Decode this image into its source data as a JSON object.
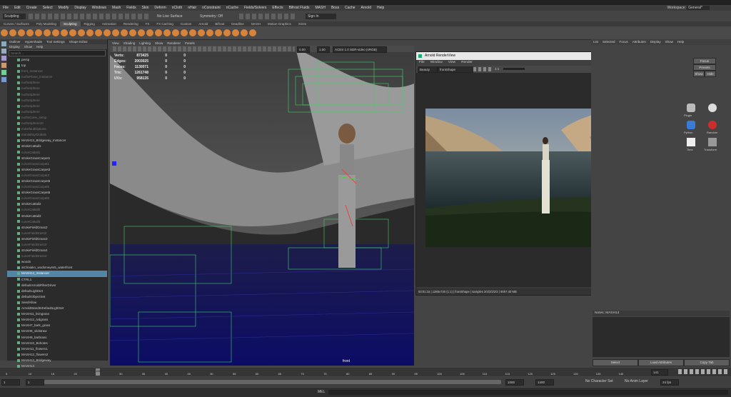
{
  "app": {
    "workspace_label": "Workspace:",
    "workspace_value": "General*"
  },
  "menubar": [
    "File",
    "Edit",
    "Create",
    "Select",
    "Modify",
    "Display",
    "Windows",
    "Mash",
    "Fields",
    "Skin",
    "Deform",
    "nCloth",
    "nHair",
    "nConstraint",
    "nCache",
    "Fields/Solvers",
    "Effects",
    "Bifrost Fluids",
    "MASH",
    "Boss",
    "Cache",
    "Arnold",
    "Help"
  ],
  "status": {
    "mode": "Sculpting",
    "surface": "No Live Surface",
    "symmetry": "Symmetry: Off",
    "sign_in": "Sign In"
  },
  "shelf_tabs": [
    "Curves / Surfaces",
    "Poly Modeling",
    "Sculpting",
    "Rigging",
    "Animation",
    "Rendering",
    "FX",
    "FX Caching",
    "Custom",
    "Arnold",
    "Bifrost",
    "Deadline",
    "MASH",
    "Motion Graphics",
    "XGen"
  ],
  "shelf_active": "Sculpting",
  "outliner": {
    "tabs": [
      "Outliner",
      "Hypershade",
      "Tool Settings",
      "Shape Editor"
    ],
    "menu": [
      "Display",
      "Show",
      "Help"
    ],
    "search_placeholder": "Search...",
    "items": [
      {
        "label": "persp",
        "dim": false
      },
      {
        "label": "top",
        "dim": false
      },
      {
        "label": "front_Instancer",
        "dim": true
      },
      {
        "label": "nurbsPlane_instancer",
        "dim": true
      },
      {
        "label": "nurbsSphere",
        "dim": true
      },
      {
        "label": "nurbsSphere",
        "dim": true
      },
      {
        "label": "nurbsSphere",
        "dim": true
      },
      {
        "label": "nurbsSphere",
        "dim": true
      },
      {
        "label": "nurbsSphere",
        "dim": true
      },
      {
        "label": "nurbsSphere",
        "dim": true
      },
      {
        "label": "nurbsCone_setup",
        "dim": true
      },
      {
        "label": "nurbsSphere10",
        "dim": true
      },
      {
        "label": "miDefaultOptions",
        "dim": true
      },
      {
        "label": "mentalrayGlobals",
        "dim": true
      },
      {
        "label": "MASH13_Bridgeway_Instancer",
        "dim": false
      },
      {
        "label": "strokeCattail1",
        "dim": false
      },
      {
        "label": "curveCattail1",
        "dim": true
      },
      {
        "label": "strokeGrassCarpet1",
        "dim": false
      },
      {
        "label": "curveGrassCarpet1",
        "dim": true
      },
      {
        "label": "strokeGrassCarpet3",
        "dim": false
      },
      {
        "label": "curveGrassCarpet3",
        "dim": true
      },
      {
        "label": "strokeGrassCarpet5",
        "dim": false
      },
      {
        "label": "curveGrassCarpet5",
        "dim": true
      },
      {
        "label": "strokeGrassCarpet6",
        "dim": false
      },
      {
        "label": "curveGrassCarpet6",
        "dim": true
      },
      {
        "label": "strokeCattail2",
        "dim": false
      },
      {
        "label": "curveCattail2",
        "dim": true
      },
      {
        "label": "strokeCattail3",
        "dim": false
      },
      {
        "label": "curveCattail3",
        "dim": true
      },
      {
        "label": "strokeFieldGrass2",
        "dim": false
      },
      {
        "label": "curveFieldGrass2",
        "dim": true
      },
      {
        "label": "strokeFieldGrass3",
        "dim": false
      },
      {
        "label": "curveFieldGrass3",
        "dim": true
      },
      {
        "label": "strokeFieldGrass4",
        "dim": false
      },
      {
        "label": "curveFieldGrass4",
        "dim": true
      },
      {
        "label": "woods",
        "dim": false
      },
      {
        "label": "aiChaiakn_wodsmeyes5_waterfront",
        "dim": false
      },
      {
        "label": "MASH14_Instancer",
        "dim": false,
        "selected": true
      },
      {
        "label": "CTRL1",
        "dim": false
      },
      {
        "label": "defaultArnoldFilterDriver",
        "dim": false
      },
      {
        "label": "defaultLightSet",
        "dim": false
      },
      {
        "label": "defaultObjectSet",
        "dim": false
      },
      {
        "label": "SeedAllow",
        "dim": false
      },
      {
        "label": "ArnoldStandInDefaultLightSet",
        "dim": false
      },
      {
        "label": "MASH11_livingrass",
        "dim": false
      },
      {
        "label": "MASH12_ivdgrass",
        "dim": false
      },
      {
        "label": "MASH7_bark_grass",
        "dim": false
      },
      {
        "label": "MASH8_sildstraw",
        "dim": false
      },
      {
        "label": "MASH9_barbrass",
        "dim": false
      },
      {
        "label": "MASH10_Bshotes",
        "dim": false
      },
      {
        "label": "MASH11_flowers1",
        "dim": false
      },
      {
        "label": "MASH12_flowers2",
        "dim": false
      },
      {
        "label": "MASH13_Bridgeway",
        "dim": false
      },
      {
        "label": "MASH14",
        "dim": false
      }
    ]
  },
  "viewport": {
    "menu": [
      "View",
      "Shading",
      "Lighting",
      "Show",
      "Renderer",
      "Panels"
    ],
    "colorspace": "ACES 1.0 SDR-video (sRGB)",
    "gamma": "1.00",
    "exposure": "0.00",
    "hud": [
      {
        "key": "Verts:",
        "val": "873425",
        "z1": "0",
        "z2": "0"
      },
      {
        "key": "Edges:",
        "val": "2003025",
        "z1": "0",
        "z2": "0"
      },
      {
        "key": "Faces:",
        "val": "1130071",
        "z1": "0",
        "z2": "0"
      },
      {
        "key": "Tris:",
        "val": "1261748",
        "z1": "0",
        "z2": "0"
      },
      {
        "key": "UVs:",
        "val": "958135",
        "z1": "0",
        "z2": "0"
      }
    ],
    "camera": "front"
  },
  "render_view": {
    "title": "Arnold RenderView",
    "menu": [
      "File",
      "Window",
      "View",
      "Render"
    ],
    "aov": "Beauty",
    "camera": "frontShape",
    "zoom": "1:1",
    "status": "00:01:15 | 1280x720 (1:1) | frontShape | samples 3/4/2/2/2/2 | 9007.40 MB",
    "zoom_button": "fit"
  },
  "right_panel": {
    "menu": [
      "List",
      "Selected",
      "Focus",
      "Attributes",
      "Display",
      "Show",
      "Help"
    ],
    "buttons": [
      "Focus",
      "Presets",
      "Show",
      "Hide"
    ],
    "icons": [
      "Plugin",
      "Python",
      "Random",
      "Time",
      "Transform"
    ],
    "notes_label": "Notes: MASH14",
    "bottom_buttons": [
      "Select",
      "Load Attributes",
      "Copy Tab"
    ]
  },
  "timeline": {
    "start": "1",
    "current": "141",
    "end_field": "141",
    "ticks": [
      "5",
      "10",
      "15",
      "20",
      "25",
      "30",
      "35",
      "40",
      "45",
      "50",
      "55",
      "60",
      "65",
      "70",
      "75",
      "80",
      "85",
      "90",
      "95",
      "100",
      "105",
      "110",
      "115",
      "120",
      "125",
      "130",
      "135",
      "140"
    ]
  },
  "range": {
    "start": "1",
    "range_start": "1",
    "range_end": "1000",
    "end": "1400",
    "fps": "24 fps",
    "char_set": "No Character Set",
    "anim_layer": "No Anim Layer"
  },
  "cmdline": {
    "lang": "MEL"
  },
  "colors": {
    "selected": "#5285a6",
    "accent_red": "#cc2d2d",
    "wire_green": "#3fd26a"
  }
}
